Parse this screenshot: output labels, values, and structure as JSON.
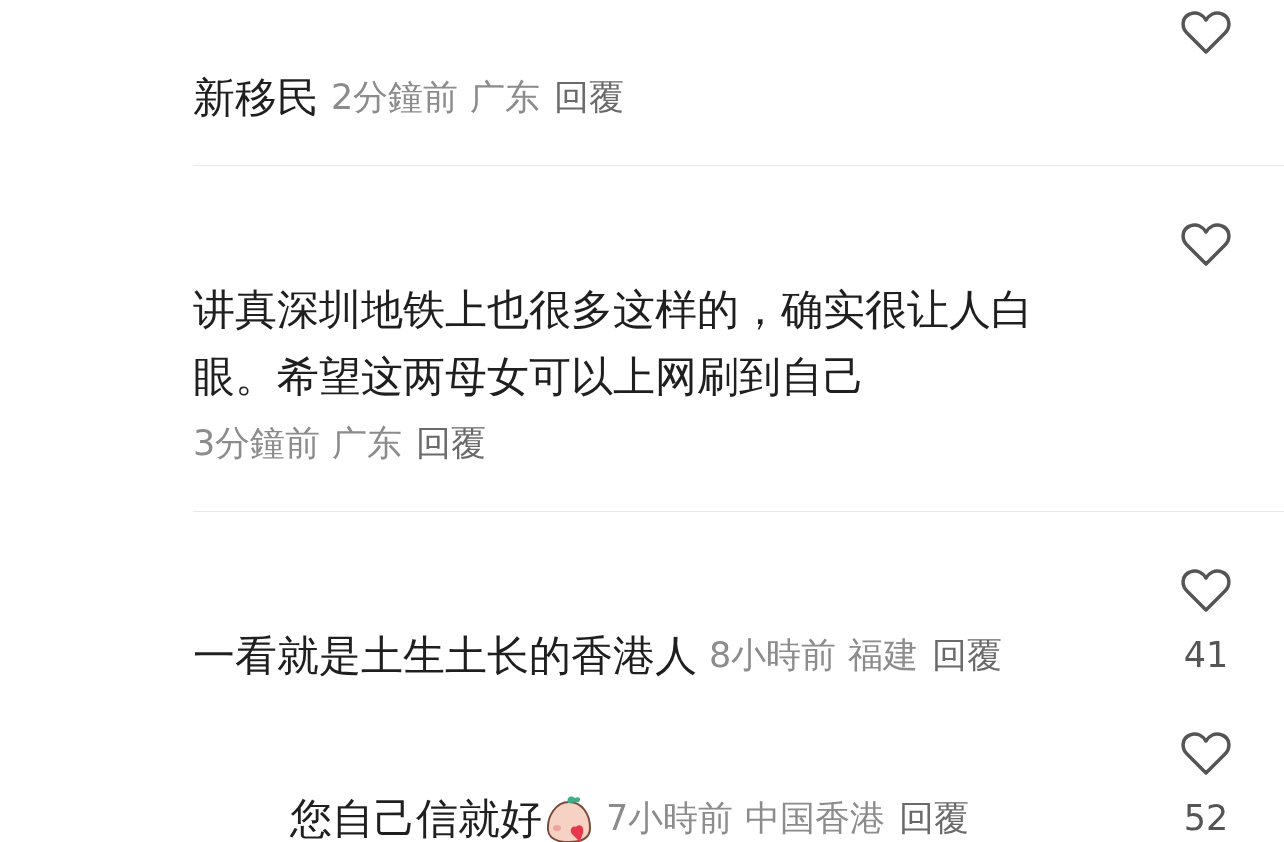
{
  "comments": [
    {
      "kind": "inline",
      "text": "新移民",
      "time": "2分鐘前",
      "location": "广东",
      "reply": "回覆",
      "liked": false
    },
    {
      "kind": "block",
      "text": "讲真深圳地铁上也很多这样的，确实很让人白眼。希望这两母女可以上网刷到自己",
      "time": "3分鐘前",
      "location": "广东",
      "reply": "回覆",
      "liked": false
    },
    {
      "kind": "inline",
      "text": "一看就是土生土长的香港人",
      "time": "8小時前",
      "location": "福建",
      "reply": "回覆",
      "liked": false,
      "likes": "41",
      "replies": [
        {
          "kind": "inline",
          "text": "您自己信就好",
          "sticker": true,
          "time": "7小時前",
          "location": "中国香港",
          "reply": "回覆",
          "liked": false,
          "likes": "52"
        }
      ]
    }
  ]
}
